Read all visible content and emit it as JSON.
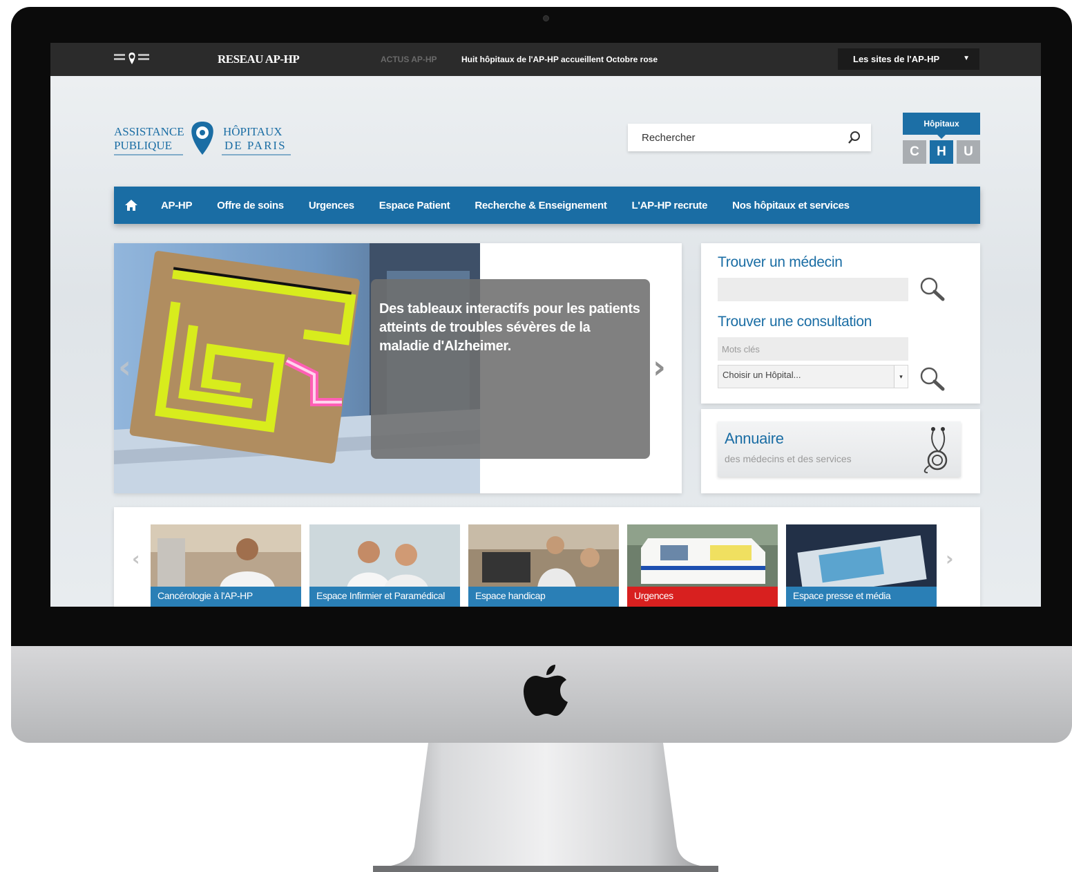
{
  "topbar": {
    "network_label": "RESEAU AP-HP",
    "news_label": "ACTUS AP-HP",
    "news_text": "Huit hôpitaux de l'AP-HP accueillent Octobre rose",
    "sites_dropdown": "Les sites de l'AP-HP"
  },
  "logo": {
    "line1_left": "ASSISTANCE",
    "line2_left": "PUBLIQUE",
    "line1_right": "HÔPITAUX",
    "line2_right": "DE PARIS"
  },
  "search": {
    "placeholder": "Rechercher"
  },
  "chu": {
    "label": "Hôpitaux",
    "letters": [
      "C",
      "H",
      "U"
    ]
  },
  "nav": {
    "items": [
      "AP-HP",
      "Offre de soins",
      "Urgences",
      "Espace Patient",
      "Recherche & Enseignement",
      "L'AP-HP recrute",
      "Nos hôpitaux et services"
    ]
  },
  "slider": {
    "caption": "Des tableaux interactifs pour les patients atteints de troubles sévères de la maladie d'Alzheimer."
  },
  "finder": {
    "doctor_title": "Trouver un médecin",
    "consult_title": "Trouver une consultation",
    "keywords_placeholder": "Mots clés",
    "hospital_select": "Choisir un Hôpital..."
  },
  "annuaire": {
    "title": "Annuaire",
    "subtitle": "des médecins et des services"
  },
  "tiles": [
    {
      "label": "Cancérologie à l'AP-HP",
      "color": "#2a7fb6"
    },
    {
      "label": "Espace Infirmier et Paramédical",
      "color": "#2a7fb6"
    },
    {
      "label": "Espace handicap",
      "color": "#2a7fb6"
    },
    {
      "label": "Urgences",
      "color": "#d8201f"
    },
    {
      "label": "Espace presse et média",
      "color": "#2a7fb6"
    }
  ],
  "colors": {
    "brand_blue": "#1a6da4",
    "urgent_red": "#d8201f",
    "topbar": "#2b2b2b"
  },
  "icons": [
    "home-icon",
    "search-icon",
    "magnifier-icon",
    "stethoscope-icon",
    "apple-logo"
  ]
}
